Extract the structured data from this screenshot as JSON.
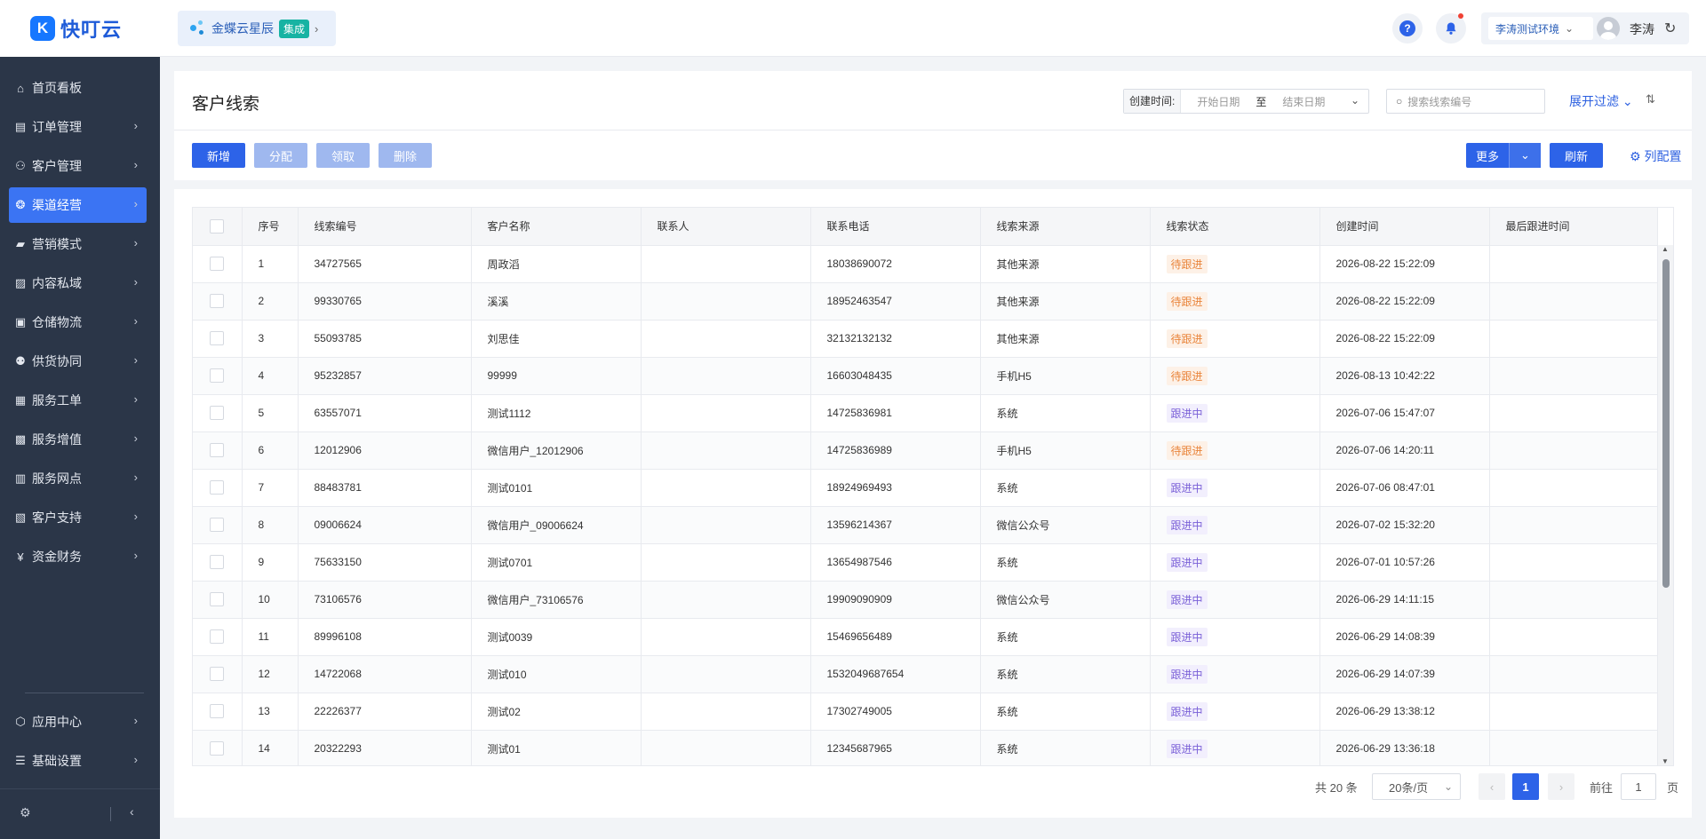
{
  "app": {
    "logo_text": "快叮云"
  },
  "integration": {
    "label": "金蝶云星辰",
    "badge": "集成"
  },
  "header": {
    "env_label": "李涛测试环境",
    "user_name": "李涛"
  },
  "sidebar": {
    "items": [
      {
        "label": "首页看板",
        "icon": "home-icon"
      },
      {
        "label": "订单管理",
        "icon": "clipboard-icon"
      },
      {
        "label": "客户管理",
        "icon": "user-icon"
      },
      {
        "label": "渠道经营",
        "icon": "channel-icon"
      },
      {
        "label": "营销模式",
        "icon": "ticket-icon"
      },
      {
        "label": "内容私域",
        "icon": "image-icon"
      },
      {
        "label": "仓储物流",
        "icon": "box-icon"
      },
      {
        "label": "供货协同",
        "icon": "user-link-icon"
      },
      {
        "label": "服务工单",
        "icon": "workorder-icon"
      },
      {
        "label": "服务增值",
        "icon": "bag-icon"
      },
      {
        "label": "服务网点",
        "icon": "store-icon"
      },
      {
        "label": "客户支持",
        "icon": "support-icon"
      },
      {
        "label": "资金财务",
        "icon": "yen-icon"
      }
    ],
    "bottom_items": [
      {
        "label": "应用中心",
        "icon": "cube-icon"
      },
      {
        "label": "基础设置",
        "icon": "settings-list-icon"
      }
    ],
    "active_index": 3
  },
  "page": {
    "title": "客户线索",
    "date_filter": {
      "label": "创建时间:",
      "start_placeholder": "开始日期",
      "separator": "至",
      "end_placeholder": "结束日期"
    },
    "search_placeholder": "搜索线索编号",
    "expand_filter": "展开过滤",
    "toolbar": {
      "add": "新增",
      "assign": "分配",
      "claim": "领取",
      "delete": "删除",
      "more": "更多",
      "refresh": "刷新",
      "column_config": "列配置"
    }
  },
  "table": {
    "headers": [
      "序号",
      "线索编号",
      "客户名称",
      "联系人",
      "联系电话",
      "线索来源",
      "线索状态",
      "创建时间",
      "最后跟进时间"
    ],
    "rows": [
      [
        "1",
        "34727565",
        "周政滔",
        "",
        "18038690072",
        "其他来源",
        "待跟进",
        "2026-08-22 15:22:09",
        ""
      ],
      [
        "2",
        "99330765",
        "溪溪",
        "",
        "18952463547",
        "其他来源",
        "待跟进",
        "2026-08-22 15:22:09",
        ""
      ],
      [
        "3",
        "55093785",
        "刘思佳",
        "",
        "32132132132",
        "其他来源",
        "待跟进",
        "2026-08-22 15:22:09",
        ""
      ],
      [
        "4",
        "95232857",
        "99999",
        "",
        "16603048435",
        "手机H5",
        "待跟进",
        "2026-08-13 10:42:22",
        ""
      ],
      [
        "5",
        "63557071",
        "测试1112",
        "",
        "14725836981",
        "系统",
        "跟进中",
        "2026-07-06 15:47:07",
        ""
      ],
      [
        "6",
        "12012906",
        "微信用户_12012906",
        "",
        "14725836989",
        "手机H5",
        "待跟进",
        "2026-07-06 14:20:11",
        ""
      ],
      [
        "7",
        "88483781",
        "测试0101",
        "",
        "18924969493",
        "系统",
        "跟进中",
        "2026-07-06 08:47:01",
        ""
      ],
      [
        "8",
        "09006624",
        "微信用户_09006624",
        "",
        "13596214367",
        "微信公众号",
        "跟进中",
        "2026-07-02 15:32:20",
        ""
      ],
      [
        "9",
        "75633150",
        "测试0701",
        "",
        "13654987546",
        "系统",
        "跟进中",
        "2026-07-01 10:57:26",
        ""
      ],
      [
        "10",
        "73106576",
        "微信用户_73106576",
        "",
        "19909090909",
        "微信公众号",
        "跟进中",
        "2026-06-29 14:11:15",
        ""
      ],
      [
        "11",
        "89996108",
        "测试0039",
        "",
        "15469656489",
        "系统",
        "跟进中",
        "2026-06-29 14:08:39",
        ""
      ],
      [
        "12",
        "14722068",
        "测试010",
        "",
        "1532049687654",
        "系统",
        "跟进中",
        "2026-06-29 14:07:39",
        ""
      ],
      [
        "13",
        "22226377",
        "测试02",
        "",
        "17302749005",
        "系统",
        "跟进中",
        "2026-06-29 13:38:12",
        ""
      ],
      [
        "14",
        "20322293",
        "测试01",
        "",
        "12345687965",
        "系统",
        "跟进中",
        "2026-06-29 13:36:18",
        ""
      ]
    ]
  },
  "pagination": {
    "total": "共 20 条",
    "page_size": "20条/页",
    "current_page": "1",
    "goto_label": "前往",
    "goto_value": "1",
    "page_unit": "页"
  },
  "colors": {
    "primary": "#2d63e8",
    "sidebar_bg": "#2b3648",
    "status_pending": "#e9843a",
    "status_following": "#7b61d8"
  }
}
